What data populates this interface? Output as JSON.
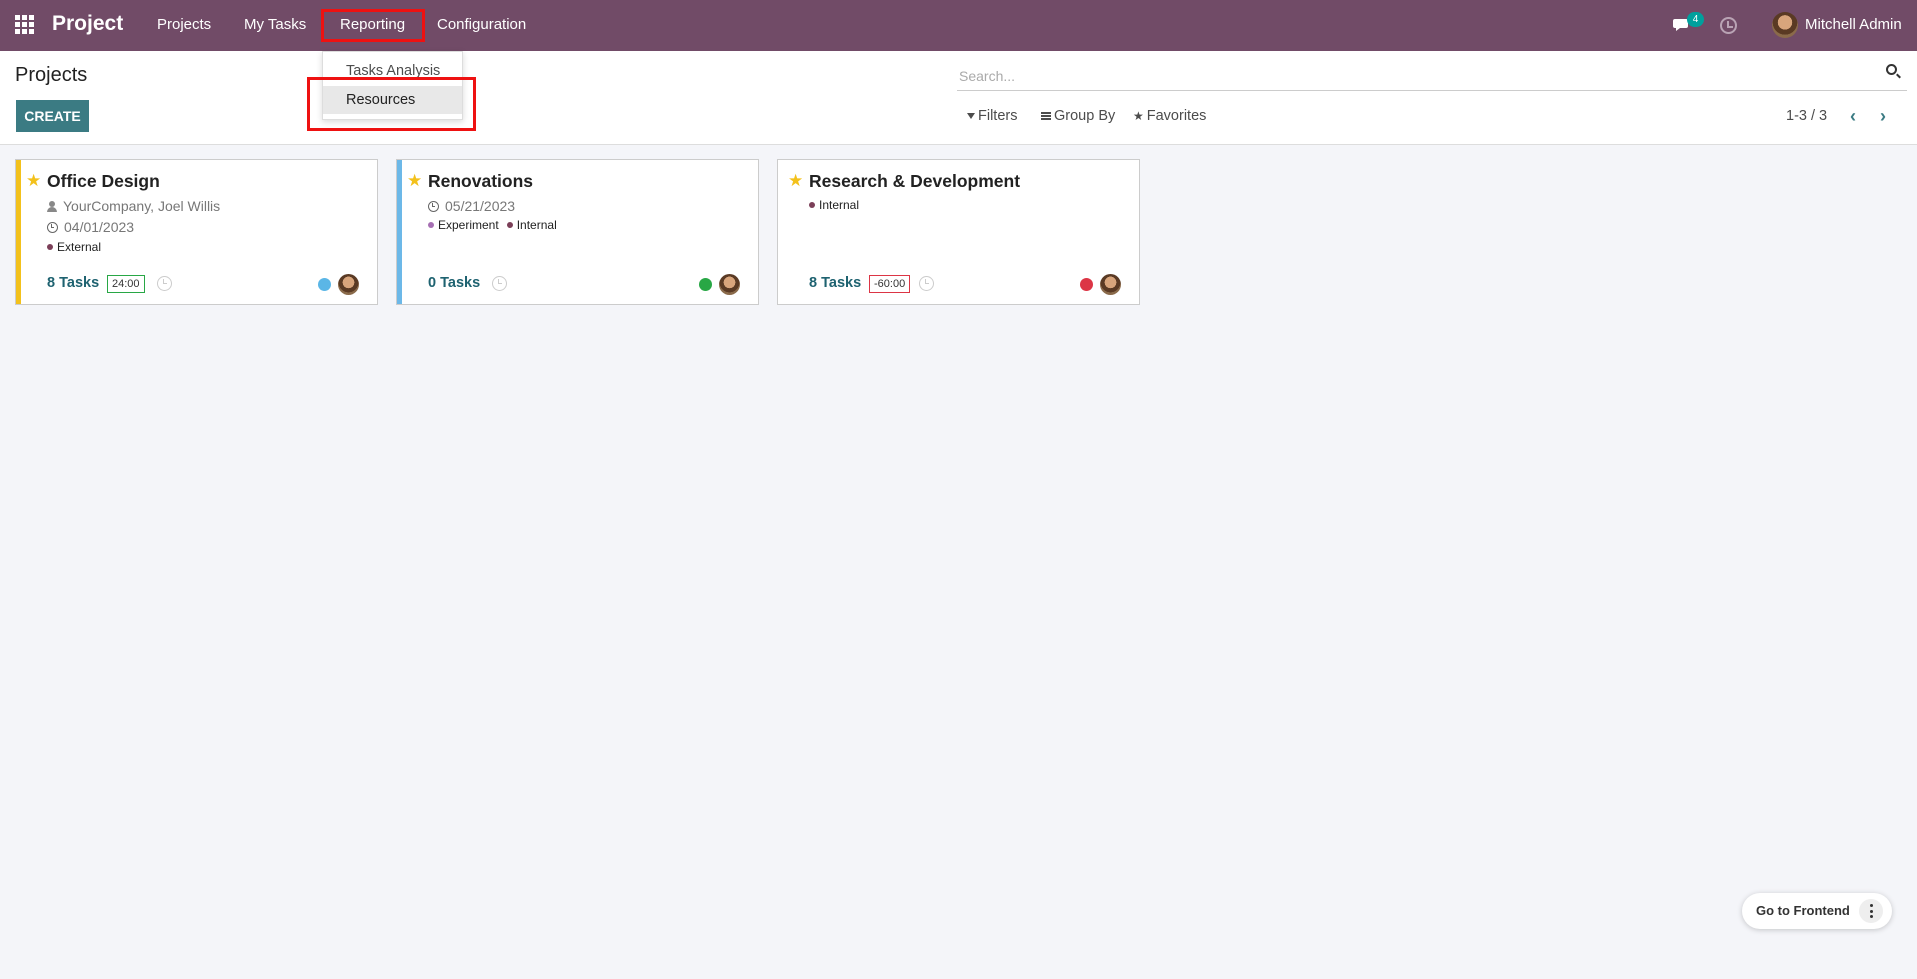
{
  "navbar": {
    "brand": "Project",
    "items": [
      {
        "label": "Projects"
      },
      {
        "label": "My Tasks"
      },
      {
        "label": "Reporting"
      },
      {
        "label": "Configuration"
      }
    ],
    "chat_badge": "4",
    "user_name": "Mitchell Admin",
    "bg_color": "#714b67"
  },
  "reporting_menu": {
    "items": [
      {
        "label": "Tasks Analysis"
      },
      {
        "label": "Resources"
      }
    ]
  },
  "control_panel": {
    "title": "Projects",
    "create_label": "CREATE",
    "search_placeholder": "Search...",
    "filters_label": "Filters",
    "groupby_label": "Group By",
    "favorites_label": "Favorites",
    "pager": "1-3 / 3"
  },
  "projects": [
    {
      "name": "Office Design",
      "customer": "YourCompany, Joel Willis",
      "date": "04/01/2023",
      "tags": [
        {
          "label": "External",
          "color": "#7b3f58"
        }
      ],
      "tasks_label": "8 Tasks",
      "hours": "24:00",
      "hours_state": "ok",
      "status_color": "#5bb6e6",
      "bar_color": "#f3c11b"
    },
    {
      "name": "Renovations",
      "date": "05/21/2023",
      "tags": [
        {
          "label": "Experiment",
          "color": "#a66fb3"
        },
        {
          "label": "Internal",
          "color": "#7b3f58"
        }
      ],
      "tasks_label": "0 Tasks",
      "status_color": "#28a745",
      "bar_color": "#6cb8e8"
    },
    {
      "name": "Research & Development",
      "tags": [
        {
          "label": "Internal",
          "color": "#7b3f58"
        }
      ],
      "tasks_label": "8 Tasks",
      "hours": "-60:00",
      "hours_state": "bad",
      "status_color": "#dc3545",
      "bar_color": ""
    }
  ],
  "frontend": {
    "label": "Go to Frontend"
  }
}
